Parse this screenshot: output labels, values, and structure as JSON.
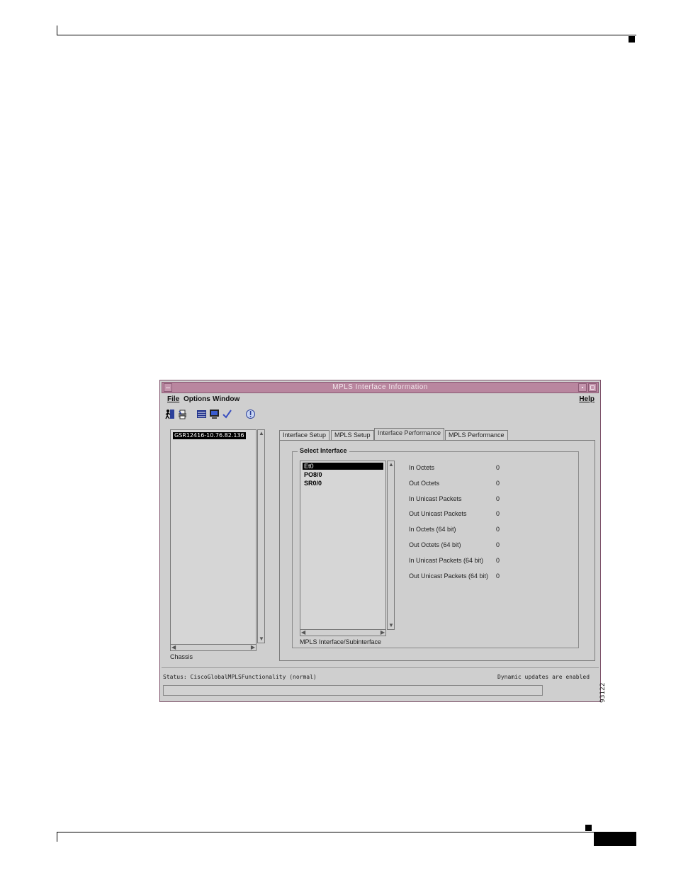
{
  "window": {
    "title": "MPLS Interface Information"
  },
  "menubar": {
    "file": "File",
    "options": "Options",
    "window": "Window",
    "help": "Help"
  },
  "toolbar": {
    "icons": [
      "exit-icon",
      "print-icon",
      "list-icon",
      "monitor-icon",
      "check-icon",
      "info-icon"
    ]
  },
  "chassis": {
    "items": [
      "GSR12416-10.76.82.136"
    ],
    "label": "Chassis"
  },
  "tabs": [
    {
      "label": "Interface Setup"
    },
    {
      "label": "MPLS Setup"
    },
    {
      "label": "Interface Performance"
    },
    {
      "label": "MPLS Performance"
    }
  ],
  "select_interface": {
    "title": "Select Interface",
    "items": [
      "Et0",
      "PO8/0",
      "SR0/0"
    ],
    "list_label": "MPLS Interface/Subinterface"
  },
  "stats": [
    {
      "label": "In Octets",
      "value": "0"
    },
    {
      "label": "Out Octets",
      "value": "0"
    },
    {
      "label": "In Unicast Packets",
      "value": "0"
    },
    {
      "label": "Out Unicast Packets",
      "value": "0"
    },
    {
      "label": "In Octets (64 bit)",
      "value": "0"
    },
    {
      "label": "Out Octets (64 bit)",
      "value": "0"
    },
    {
      "label": "In Unicast Packets (64 bit)",
      "value": "0"
    },
    {
      "label": "Out Unicast Packets (64 bit)",
      "value": "0"
    }
  ],
  "status": {
    "left": "Status: CiscoGlobalMPLSFunctionality (normal)",
    "right": "Dynamic updates are enabled"
  },
  "figure_number": "93122",
  "colors": {
    "titlebar": "#b9869f",
    "window_bg": "#cfcfcf"
  }
}
